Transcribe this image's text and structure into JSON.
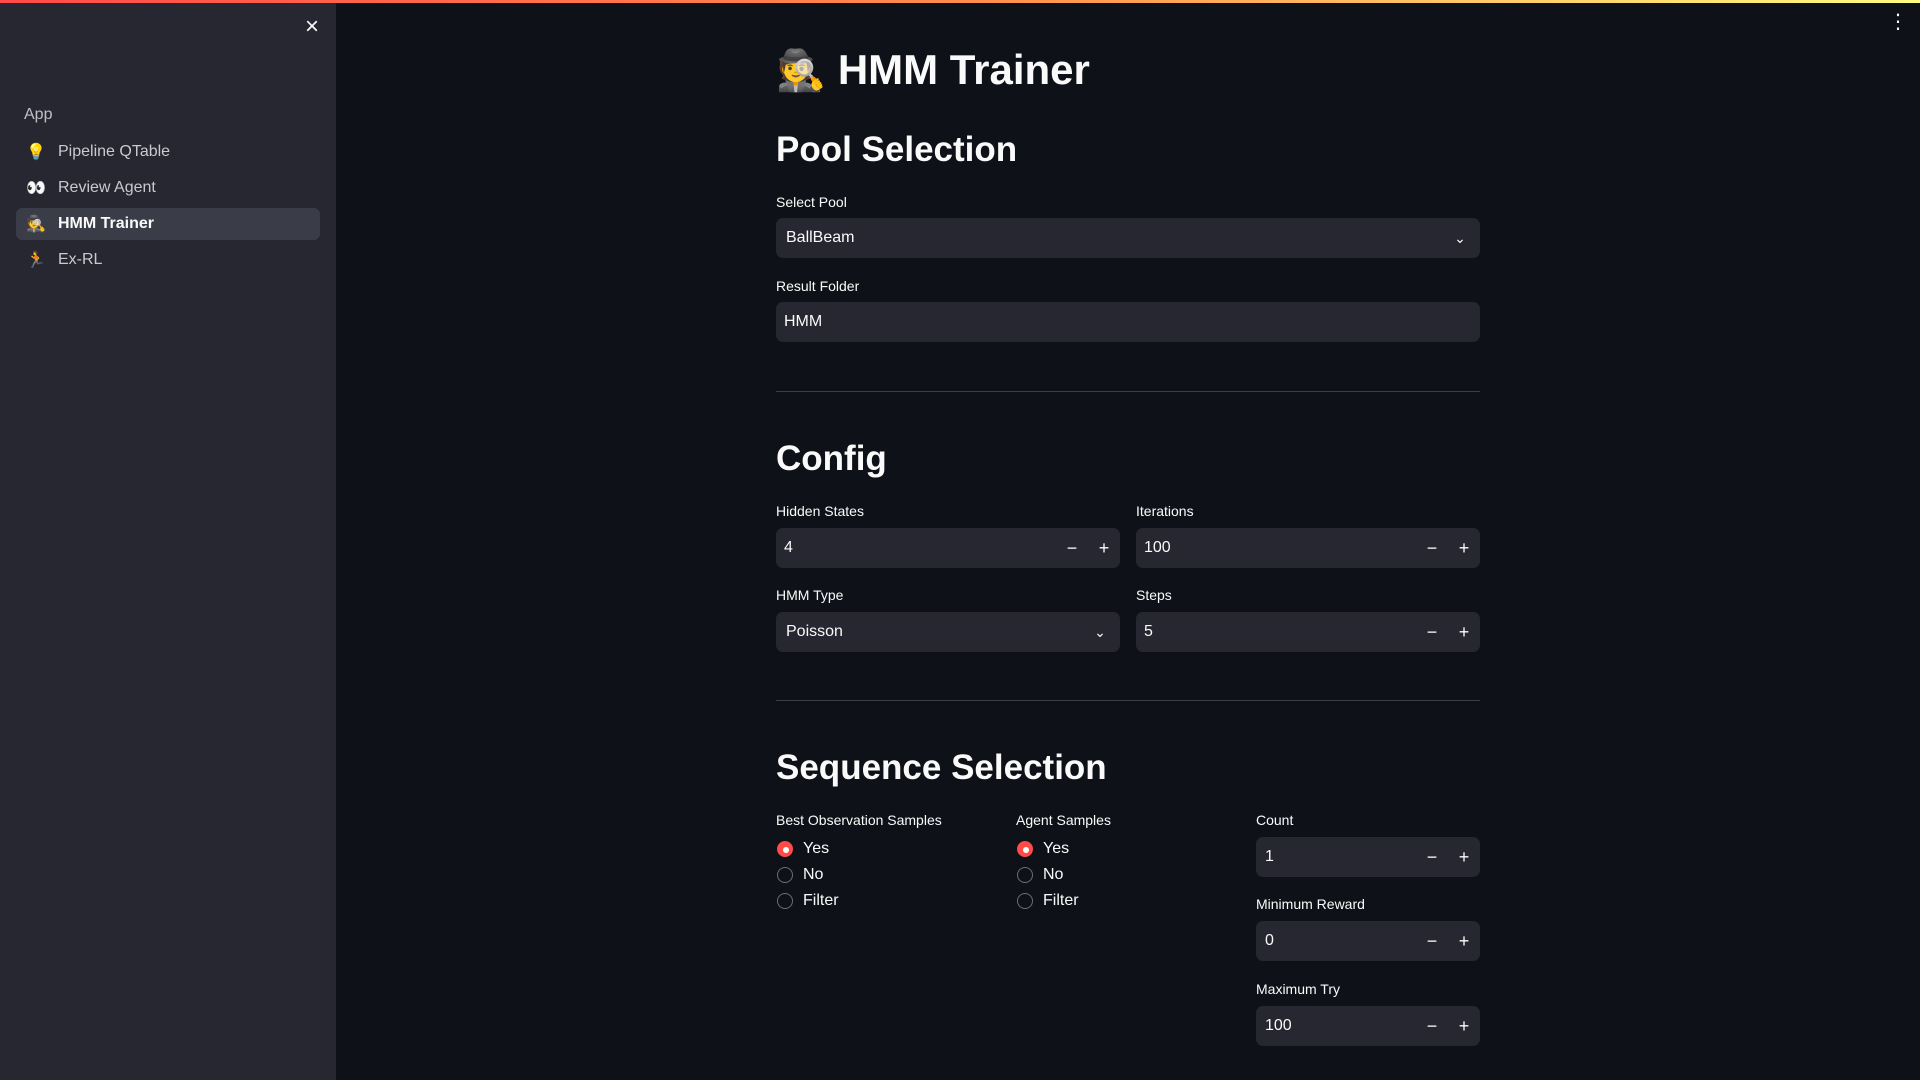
{
  "colors": {
    "background": "#0e1117",
    "sidebar": "#262730",
    "input": "#262730",
    "accent": "#ff4b4b"
  },
  "sidebar": {
    "close_icon": "close-icon",
    "header": "App",
    "items": [
      {
        "icon": "💡",
        "label": "Pipeline QTable",
        "active": false
      },
      {
        "icon": "👀",
        "label": "Review Agent",
        "active": false
      },
      {
        "icon": "🕵️",
        "label": "HMM Trainer",
        "active": true
      },
      {
        "icon": "🏃",
        "label": "Ex-RL",
        "active": false
      }
    ]
  },
  "header": {
    "menu_icon": "kebab-menu-icon"
  },
  "page": {
    "title_emoji": "🕵️",
    "title": "HMM Trainer"
  },
  "pool_selection": {
    "heading": "Pool Selection",
    "select_pool_label": "Select Pool",
    "select_pool_value": "BallBeam",
    "result_folder_label": "Result Folder",
    "result_folder_value": "HMM"
  },
  "config": {
    "heading": "Config",
    "hidden_states_label": "Hidden States",
    "hidden_states_value": "4",
    "iterations_label": "Iterations",
    "iterations_value": "100",
    "hmm_type_label": "HMM Type",
    "hmm_type_value": "Poisson",
    "steps_label": "Steps",
    "steps_value": "5"
  },
  "sequence_selection": {
    "heading": "Sequence Selection",
    "best_obs_label": "Best Observation Samples",
    "best_obs_options": [
      "Yes",
      "No",
      "Filter"
    ],
    "best_obs_selected": "Yes",
    "agent_samples_label": "Agent Samples",
    "agent_samples_options": [
      "Yes",
      "No",
      "Filter"
    ],
    "agent_samples_selected": "Yes",
    "count_label": "Count",
    "count_value": "1",
    "min_reward_label": "Minimum Reward",
    "min_reward_value": "0",
    "max_try_label": "Maximum Try",
    "max_try_value": "100"
  },
  "stepper": {
    "minus": "−",
    "plus": "+"
  }
}
